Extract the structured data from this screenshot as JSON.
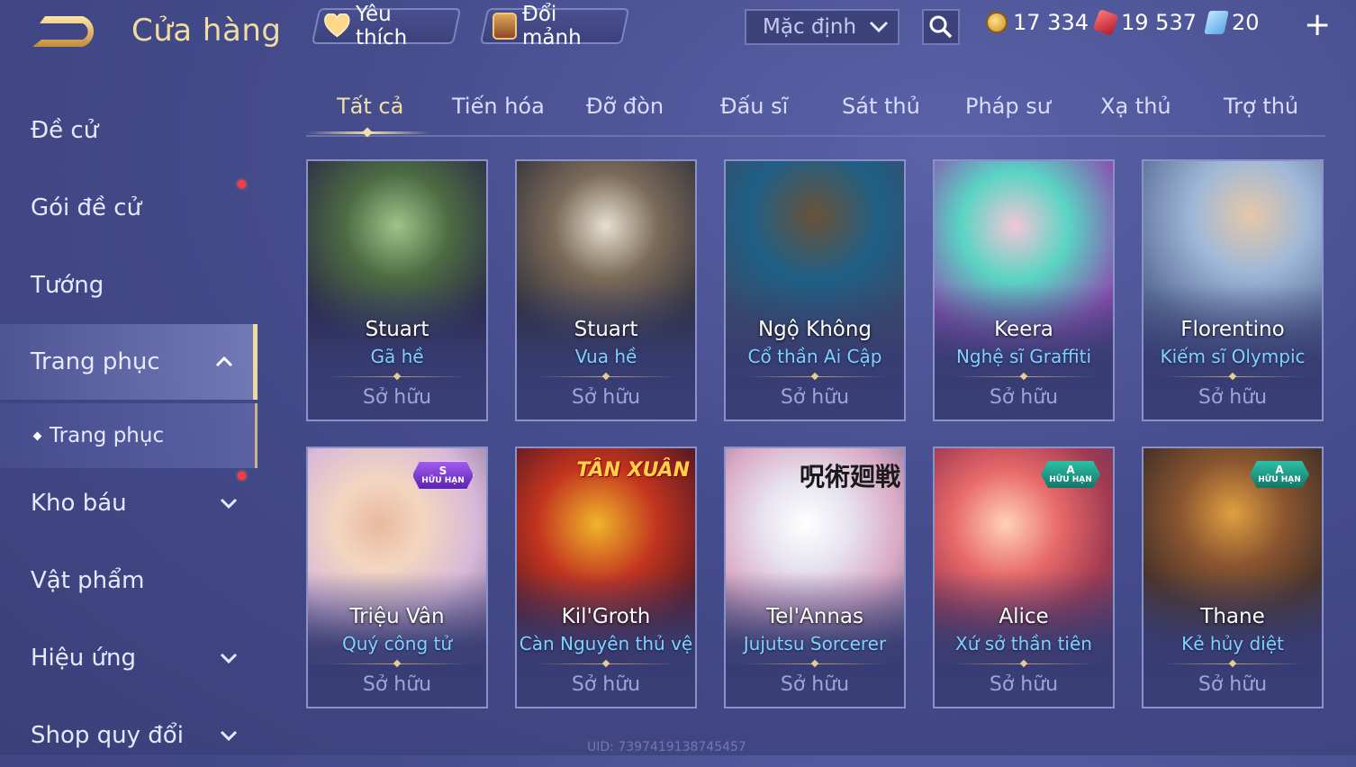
{
  "header": {
    "title": "Cửa hàng",
    "favorites_label": "Yêu thích",
    "trade_label": "Đổi mảnh",
    "sort_value": "Mặc định",
    "currencies": {
      "gold": "17 334",
      "ruby": "19 537",
      "voucher": "20"
    },
    "add_label": "+"
  },
  "sidebar": {
    "items": [
      {
        "label": "Đề cử"
      },
      {
        "label": "Gói đề cử"
      },
      {
        "label": "Tướng"
      },
      {
        "label": "Trang phục"
      },
      {
        "label": "Trang phục"
      },
      {
        "label": "Kho báu"
      },
      {
        "label": "Vật phẩm"
      },
      {
        "label": "Hiệu ứng"
      },
      {
        "label": "Shop quy đổi"
      }
    ]
  },
  "tabs": [
    "Tất cả",
    "Tiến hóa",
    "Đỡ đòn",
    "Đấu sĩ",
    "Sát thủ",
    "Pháp sư",
    "Xạ thủ",
    "Trợ thủ"
  ],
  "cards": [
    {
      "hero": "Stuart",
      "skin": "Gã hề",
      "status": "Sở hữu"
    },
    {
      "hero": "Stuart",
      "skin": "Vua hề",
      "status": "Sở hữu"
    },
    {
      "hero": "Ngộ Không",
      "skin": "Cổ thần Ai Cập",
      "status": "Sở hữu"
    },
    {
      "hero": "Keera",
      "skin": "Nghệ sĩ Graffiti",
      "status": "Sở hữu"
    },
    {
      "hero": "Florentino",
      "skin": "Kiếm sĩ Olympic",
      "status": "Sở hữu"
    },
    {
      "hero": "Triệu Vân",
      "skin": "Quý công tử",
      "status": "Sở hữu",
      "badge_tier": "S",
      "badge_text": "HỮU HẠN"
    },
    {
      "hero": "Kil'Groth",
      "skin": "Càn Nguyên thủ vệ",
      "status": "Sở hữu",
      "tag": "TÂN XUÂN"
    },
    {
      "hero": "Tel'Annas",
      "skin": "Jujutsu Sorcerer",
      "status": "Sở hữu",
      "tag": "呪術廻戦"
    },
    {
      "hero": "Alice",
      "skin": "Xứ sở thần tiên",
      "status": "Sở hữu",
      "badge_tier": "A",
      "badge_text": "HỮU HẠN"
    },
    {
      "hero": "Thane",
      "skin": "Kẻ hủy diệt",
      "status": "Sở hữu",
      "badge_tier": "A",
      "badge_text": "HỮU HẠN"
    }
  ],
  "footer": {
    "uid": "UID: 7397419138745457"
  },
  "colors": {
    "accent_gold": "#f1dca3",
    "skin_blue": "#7fd2ff",
    "notify_red": "#ff3b3b"
  }
}
